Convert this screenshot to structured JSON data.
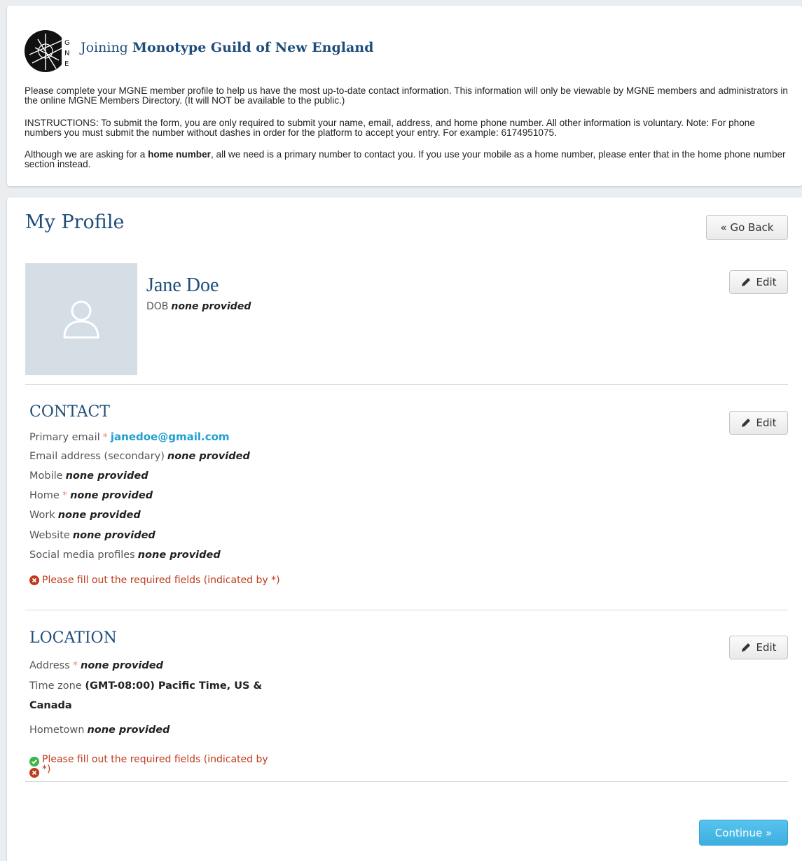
{
  "header": {
    "logo_letters": [
      "G",
      "N",
      "E"
    ],
    "title_prefix": "Joining",
    "title_org": "Monotype Guild of New England",
    "intro_1": "Please complete your MGNE member profile to help us have the most up-to-date contact information. This information will only be viewable by MGNE members and administrators in the online MGNE Members Directory. (It will NOT be available to the public.)",
    "intro_2": "INSTRUCTIONS: To submit the form, you are only required to submit your name, email, address, and home phone number. All other information is voluntary. Note: For phone numbers you must submit the number without dashes in order for the platform to accept your entry. For example: 6174951075.",
    "intro_3_before": "Although we are asking for a ",
    "intro_3_bold": "home number",
    "intro_3_after": ", all we need is a primary number to contact you. If you use your mobile as a home number, please enter that in the home phone number section instead."
  },
  "profile": {
    "page_title": "My Profile",
    "go_back_label": "« Go Back",
    "edit_label": "Edit",
    "name": "Jane Doe",
    "dob_label": "DOB",
    "dob_value": "none provided"
  },
  "contact": {
    "title": "CONTACT",
    "required_mark": "*",
    "fields": [
      {
        "label": "Primary email",
        "value": "janedoe@gmail.com"
      },
      {
        "label": "Email address (secondary)",
        "value": "none provided"
      },
      {
        "label": "Mobile",
        "value": "none provided"
      },
      {
        "label": "Home",
        "value": "none provided"
      },
      {
        "label": "Work",
        "value": "none provided"
      },
      {
        "label": "Website",
        "value": "none provided"
      },
      {
        "label": "Social media profiles",
        "value": "none provided"
      }
    ],
    "warning": "Please fill out the required fields (indicated by *)"
  },
  "location": {
    "title": "LOCATION",
    "fields": [
      {
        "label": "Address",
        "value": "none provided"
      },
      {
        "label": "Time zone",
        "value": "(GMT-08:00) Pacific Time, US & Canada"
      },
      {
        "label": "Hometown",
        "value": "none provided"
      }
    ],
    "warning_line1": "Please fill out the required fields (indicated by",
    "warning_line2": "*)"
  },
  "footer": {
    "continue_label": "Continue »"
  },
  "colors": {
    "brand": "#1f4d7a",
    "link": "#1f9fd1",
    "error": "#c0391b",
    "success": "#3cb54a",
    "continue": "#4db8e8"
  },
  "icons": {
    "logo": "gne-logo-icon",
    "avatar": "user-silhouette-icon",
    "edit": "pencil-icon",
    "error": "error-circle-icon",
    "success": "check-circle-icon"
  }
}
